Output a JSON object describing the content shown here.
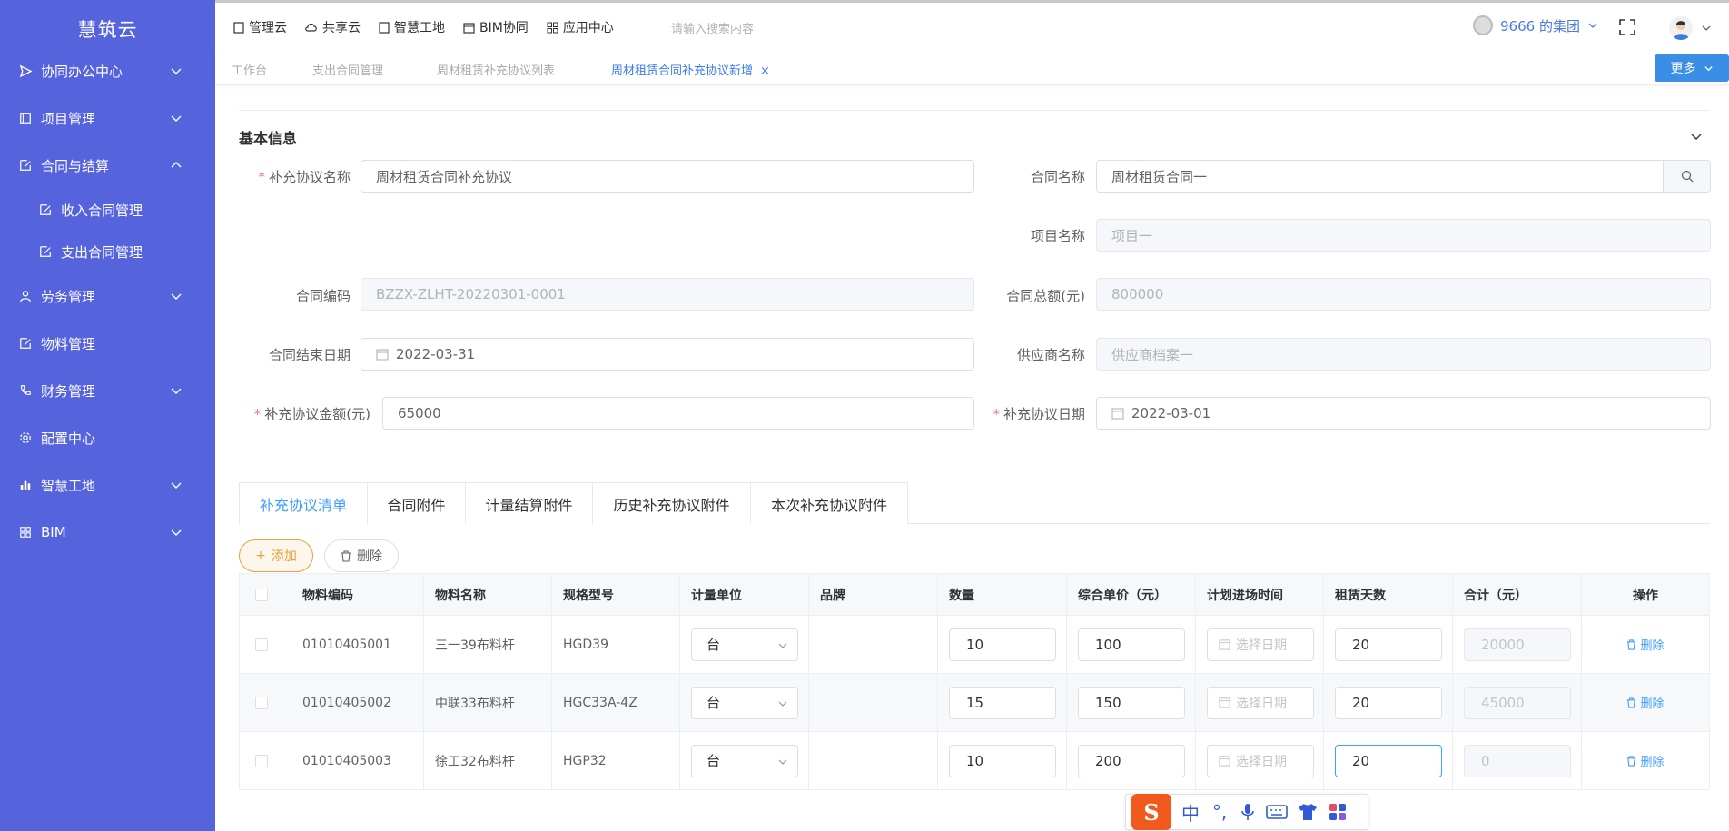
{
  "app": {
    "brand": "慧筑云"
  },
  "sidebar": {
    "items": [
      {
        "label": "协同办公中心",
        "expanded": false,
        "has_children": true
      },
      {
        "label": "项目管理",
        "expanded": false,
        "has_children": true
      },
      {
        "label": "合同与结算",
        "expanded": true,
        "has_children": true
      },
      {
        "label": "收入合同管理",
        "sub": true
      },
      {
        "label": "支出合同管理",
        "sub": true
      },
      {
        "label": "劳务管理",
        "expanded": false,
        "has_children": true
      },
      {
        "label": "物料管理",
        "has_children": false
      },
      {
        "label": "财务管理",
        "expanded": false,
        "has_children": true
      },
      {
        "label": "配置中心",
        "has_children": false
      },
      {
        "label": "智慧工地",
        "expanded": false,
        "has_children": true
      },
      {
        "label": "BIM",
        "expanded": false,
        "has_children": true
      }
    ]
  },
  "topnav": {
    "items": [
      "管理云",
      "共享云",
      "智慧工地",
      "BIM协同",
      "应用中心"
    ],
    "search_placeholder": "请输入搜索内容",
    "group_label": "9666 的集团"
  },
  "page_tabs": [
    {
      "label": "工作台",
      "active": false
    },
    {
      "label": "支出合同管理",
      "active": false
    },
    {
      "label": "周材租赁补充协议列表",
      "active": false
    },
    {
      "label": "周材租赁合同补充协议新增",
      "active": true,
      "close": "×"
    }
  ],
  "more_button": "更多",
  "section": {
    "title": "基本信息"
  },
  "form": {
    "supplement_name": {
      "label": "补充协议名称",
      "required": true,
      "value": "周材租赁合同补充协议"
    },
    "contract_name": {
      "label": "合同名称",
      "value": "周材租赁合同一"
    },
    "project_name": {
      "label": "项目名称",
      "value": "项目一",
      "disabled": true
    },
    "contract_code": {
      "label": "合同编码",
      "value": "BZZX-ZLHT-20220301-0001",
      "disabled": true
    },
    "contract_total": {
      "label": "合同总额(元)",
      "value": "800000",
      "disabled": true
    },
    "contract_end_date": {
      "label": "合同结束日期",
      "value": "2022-03-31"
    },
    "supplier_name": {
      "label": "供应商名称",
      "value": "供应商档案一",
      "disabled": true
    },
    "supplement_amount": {
      "label": "补充协议金额(元)",
      "required": true,
      "value": "65000"
    },
    "supplement_date": {
      "label": "补充协议日期",
      "required": true,
      "value": "2022-03-01"
    }
  },
  "sub_tabs": [
    {
      "label": "补充协议清单",
      "active": true
    },
    {
      "label": "合同附件",
      "active": false
    },
    {
      "label": "计量结算附件",
      "active": false
    },
    {
      "label": "历史补充协议附件",
      "active": false
    },
    {
      "label": "本次补充协议附件",
      "active": false
    }
  ],
  "actions": {
    "add": "添加",
    "delete": "删除"
  },
  "table": {
    "headers": [
      "物料编码",
      "物料名称",
      "规格型号",
      "计量单位",
      "品牌",
      "数量",
      "综合单价（元）",
      "计划进场时间",
      "租赁天数",
      "合计（元）",
      "操作"
    ],
    "date_placeholder": "选择日期",
    "delete_label": "删除",
    "rows": [
      {
        "code": "01010405001",
        "name": "三一39布料杆",
        "spec": "HGD39",
        "unit": "台",
        "brand": "",
        "qty": "10",
        "price": "100",
        "date": "",
        "days": "20",
        "total": "20000"
      },
      {
        "code": "01010405002",
        "name": "中联33布料杆",
        "spec": "HGC33A-4Z",
        "unit": "台",
        "brand": "",
        "qty": "15",
        "price": "150",
        "date": "",
        "days": "20",
        "total": "45000"
      },
      {
        "code": "01010405003",
        "name": "徐工32布料杆",
        "spec": "HGP32",
        "unit": "台",
        "brand": "",
        "qty": "10",
        "price": "200",
        "date": "",
        "days": "20",
        "total": "0"
      }
    ]
  },
  "ime": {
    "logo": "S",
    "lang": "中",
    "punct": "°,"
  }
}
